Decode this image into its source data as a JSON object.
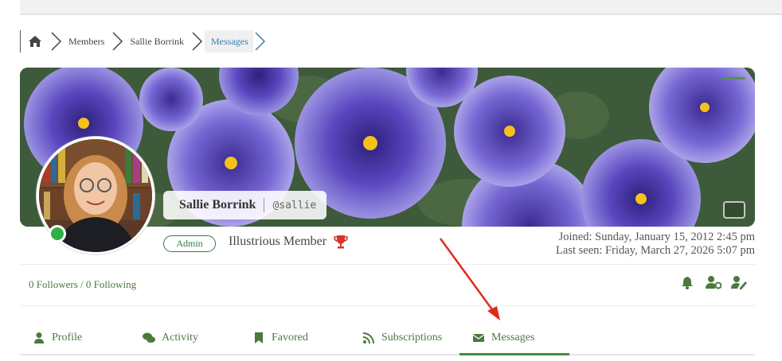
{
  "breadcrumb": {
    "home_icon": "home-icon",
    "items": [
      "Members",
      "Sallie Borrink",
      "Messages"
    ]
  },
  "profile": {
    "display_name": "Sallie Borrink",
    "handle": "@sallie",
    "role": "Admin",
    "rank": "Illustrious Member",
    "rank_icon": "trophy-icon",
    "joined": "Joined: Sunday, January 15, 2012 2:45 pm",
    "last_seen": "Last seen: Friday, March 27, 2026 5:07 pm",
    "online": true,
    "follow_text": "0 Followers / 0 Following"
  },
  "actions": [
    "bell-icon",
    "user-settings-icon",
    "user-edit-icon"
  ],
  "tabs": [
    {
      "label": "Profile",
      "icon": "user-icon"
    },
    {
      "label": "Activity",
      "icon": "comments-icon"
    },
    {
      "label": "Favored",
      "icon": "bookmark-icon"
    },
    {
      "label": "Subscriptions",
      "icon": "rss-icon"
    },
    {
      "label": "Messages",
      "icon": "envelope-icon",
      "active": true
    }
  ],
  "colors": {
    "accent_green": "#4b7a3c",
    "online_green": "#2fae44",
    "link_blue": "#3b7ea8",
    "annotation_red": "#e02a1f",
    "trophy_red": "#d9342b"
  }
}
